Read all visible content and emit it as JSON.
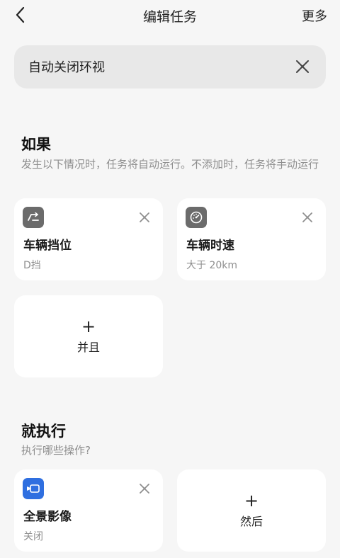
{
  "header": {
    "title": "编辑任务",
    "more_label": "更多"
  },
  "task_name": {
    "value": "自动关闭环视"
  },
  "if_section": {
    "title": "如果",
    "description": "发生以下情况时，任务将自动运行。不添加时，任务将手动运行",
    "conditions": [
      {
        "icon": "gear-shift-icon",
        "title": "车辆挡位",
        "value": "D挡"
      },
      {
        "icon": "speedometer-icon",
        "title": "车辆时速",
        "value": "大于 20km"
      }
    ],
    "add_label": "并且",
    "add_symbol": "+"
  },
  "then_section": {
    "title": "就执行",
    "description": "执行哪些操作?",
    "actions": [
      {
        "icon": "panoramic-camera-icon",
        "title": "全景影像",
        "value": "关闭"
      }
    ],
    "add_label": "然后",
    "add_symbol": "+"
  },
  "colors": {
    "background": "#f6f6f6",
    "card": "#ffffff",
    "condition_icon_bg": "#6b6b6b",
    "action_icon_bg": "#2f6fe0",
    "secondary_text": "#8e8e8e"
  }
}
